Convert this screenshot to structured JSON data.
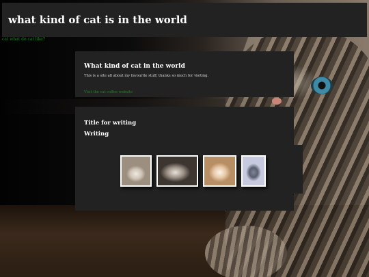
{
  "header": {
    "title": "what kind of cat is in the world"
  },
  "nav": {
    "link": "cat what do cat like?"
  },
  "intro": {
    "title": "What kind of cat in the world",
    "text": "This is a site all about my favourite stuff, thanks so much for visiting.",
    "link": "Visit the cat coffee website"
  },
  "writing": {
    "title": "Title for writing",
    "subtitle": "Writing"
  },
  "gallery": {
    "images": [
      "white kitten",
      "fluffy cat",
      "cream kitten",
      "grey cat"
    ]
  },
  "colors": {
    "panel": "#222222",
    "link": "#1d8a1d",
    "text": "#ffffff"
  }
}
